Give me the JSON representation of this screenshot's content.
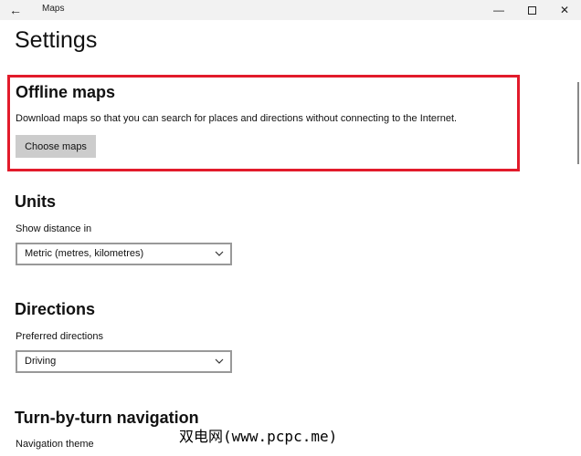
{
  "window": {
    "app_title": "Maps",
    "back_icon": "arrow-left-icon",
    "minimize_icon": "minimize-icon",
    "maximize_icon": "maximize-icon",
    "close_icon": "close-icon"
  },
  "page": {
    "title": "Settings"
  },
  "offline_maps": {
    "title": "Offline maps",
    "description": "Download maps so that you can search for places and directions without connecting to the Internet.",
    "button_label": "Choose maps",
    "highlight_color": "#e21b2b"
  },
  "units": {
    "title": "Units",
    "label": "Show distance in",
    "selected": "Metric (metres, kilometres)"
  },
  "directions": {
    "title": "Directions",
    "label": "Preferred directions",
    "selected": "Driving"
  },
  "navigation": {
    "title": "Turn-by-turn navigation",
    "theme_label": "Navigation theme"
  },
  "watermark": {
    "text": "双电网(www.pcpc.me)"
  }
}
